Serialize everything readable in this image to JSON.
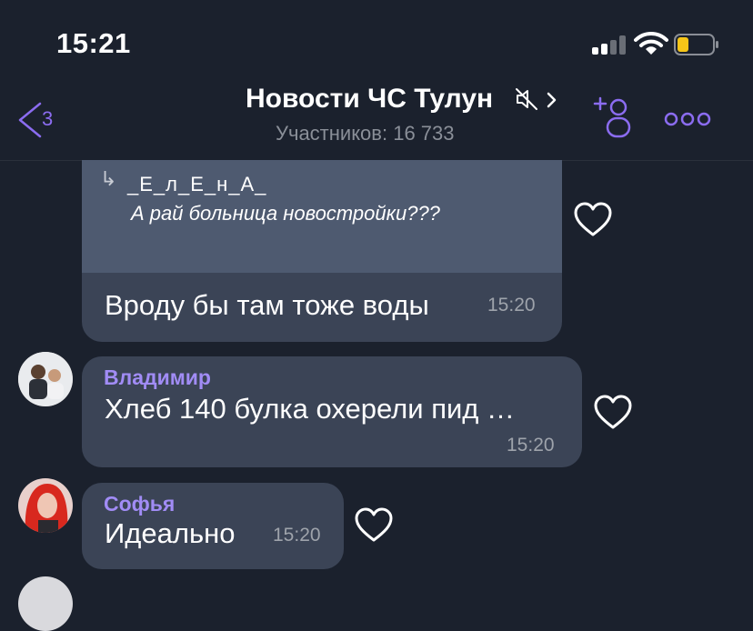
{
  "status_bar": {
    "time": "15:21"
  },
  "header": {
    "back_count": "3",
    "title": "Новости ЧС Тулун",
    "subtitle": "Участников: 16 733"
  },
  "messages": [
    {
      "reply_to": {
        "name": "_Е_л_Е_н_А_",
        "text": "А рай больница новостройки???"
      },
      "text": "Вроду бы там тоже воды",
      "time": "15:20"
    },
    {
      "sender": "Владимир",
      "text": "Хлеб 140 булка  охерели пид …",
      "time": "15:20"
    },
    {
      "sender": "Софья",
      "text": "Идеально",
      "time": "15:20"
    }
  ],
  "colors": {
    "accent": "#8b6cf0",
    "sender_name": "#a18cf5",
    "bubble": "#3b4456",
    "background": "#1b212d"
  }
}
